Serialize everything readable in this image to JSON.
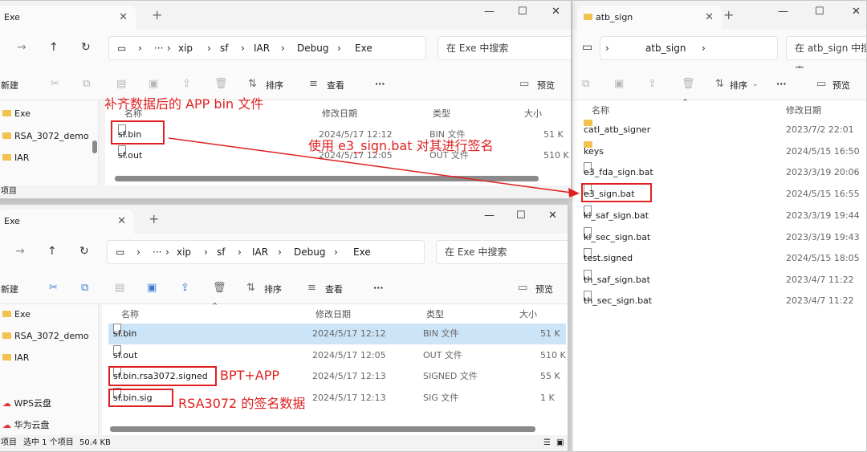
{
  "colors": {
    "annotation": "#e02020",
    "selected_row": "#cce4f7",
    "folder": "#f2c14e"
  },
  "win1": {
    "tab_title": "Exe",
    "address": [
      "xip",
      "sf",
      "IAR",
      "Debug",
      "Exe"
    ],
    "search_placeholder": "在 Exe 中搜索",
    "toolbar": {
      "new": "新建",
      "sort": "排序",
      "view": "查看",
      "more": "···",
      "preview": "预览"
    },
    "sidebar": [
      "Exe",
      "RSA_3072_demo",
      "IAR"
    ],
    "columns": {
      "name": "名称",
      "date": "修改日期",
      "type": "类型",
      "size": "大小"
    },
    "files": [
      {
        "name": "sf.bin",
        "date": "2024/5/17 12:12",
        "type": "BIN 文件",
        "size": "51 K"
      },
      {
        "name": "sf.out",
        "date": "2024/5/17 12:05",
        "type": "OUT 文件",
        "size": "510 K"
      }
    ],
    "status": "项目"
  },
  "win2": {
    "tab_title": "Exe",
    "address": [
      "xip",
      "sf",
      "IAR",
      "Debug",
      "Exe"
    ],
    "search_placeholder": "在 Exe 中搜索",
    "toolbar": {
      "new": "新建",
      "sort": "排序",
      "view": "查看",
      "more": "···",
      "preview": "预览"
    },
    "sidebar": [
      "Exe",
      "RSA_3072_demo",
      "IAR",
      "WPS云盘",
      "华为云盘"
    ],
    "columns": {
      "name": "名称",
      "date": "修改日期",
      "type": "类型",
      "size": "大小"
    },
    "files": [
      {
        "name": "sf.bin",
        "date": "2024/5/17 12:12",
        "type": "BIN 文件",
        "size": "51 K"
      },
      {
        "name": "sf.out",
        "date": "2024/5/17 12:05",
        "type": "OUT 文件",
        "size": "510 K"
      },
      {
        "name": "sf.bin.rsa3072.signed",
        "date": "2024/5/17 12:13",
        "type": "SIGNED 文件",
        "size": "55 K"
      },
      {
        "name": "sf.bin.sig",
        "date": "2024/5/17 12:13",
        "type": "SIG 文件",
        "size": "1 K"
      }
    ],
    "status": {
      "items": "项目",
      "selected": "选中 1 个项目",
      "size": "50.4 KB"
    }
  },
  "win3": {
    "tab_title": "atb_sign",
    "address": [
      "atb_sign"
    ],
    "search_placeholder": "在 atb_sign 中搜索",
    "toolbar": {
      "sort": "排序",
      "more": "···",
      "preview": "预览"
    },
    "columns": {
      "name": "名称",
      "date": "修改日期"
    },
    "files": [
      {
        "name": "catl_atb_signer",
        "date": "2023/7/2 22:01",
        "kind": "folder"
      },
      {
        "name": "keys",
        "date": "2024/5/15 16:50",
        "kind": "folder"
      },
      {
        "name": "e3_fda_sign.bat",
        "date": "2023/3/19 20:06",
        "kind": "bat"
      },
      {
        "name": "e3_sign.bat",
        "date": "2024/5/15 16:55",
        "kind": "bat"
      },
      {
        "name": "kl_saf_sign.bat",
        "date": "2023/3/19 19:44",
        "kind": "bat"
      },
      {
        "name": "kl_sec_sign.bat",
        "date": "2023/3/19 19:43",
        "kind": "bat"
      },
      {
        "name": "test.signed",
        "date": "2024/5/15 18:05",
        "kind": "file"
      },
      {
        "name": "th_saf_sign.bat",
        "date": "2023/4/7 11:22",
        "kind": "bat"
      },
      {
        "name": "th_sec_sign.bat",
        "date": "2023/4/7 11:22",
        "kind": "bat"
      }
    ]
  },
  "annotations": {
    "padded_file": "补齐数据后的 APP bin 文件",
    "sign_with": "使用 e3_sign.bat 对其进行签名",
    "bpt_app": "BPT+APP",
    "sig_data": "RSA3072 的签名数据"
  }
}
